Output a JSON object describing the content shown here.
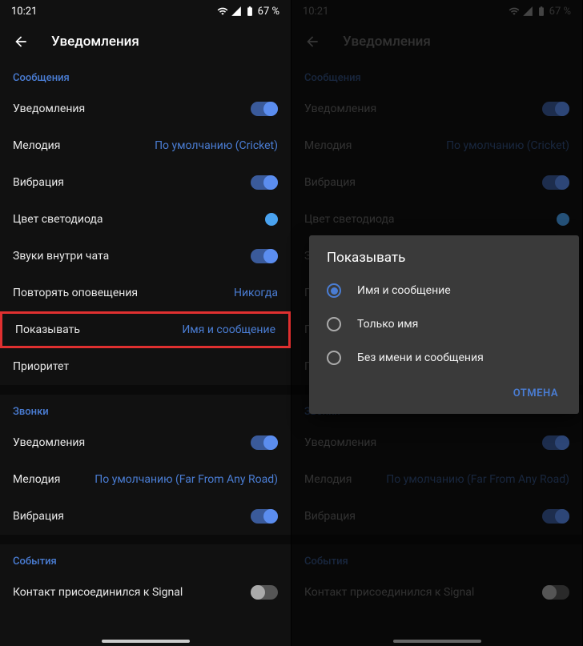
{
  "status": {
    "time": "10:21",
    "battery": "67 %"
  },
  "header": {
    "title": "Уведомления"
  },
  "sections": {
    "messages": {
      "header": "Сообщения",
      "notifications": "Уведомления",
      "melody": "Мелодия",
      "melody_value": "По умолчанию (Cricket)",
      "vibration": "Вибрация",
      "led": "Цвет светодиода",
      "chat_sounds": "Звуки внутри чата",
      "repeat": "Повторять оповещения",
      "repeat_value": "Никогда",
      "show": "Показывать",
      "show_value": "Имя и сообщение",
      "priority": "Приоритет"
    },
    "calls": {
      "header": "Звонки",
      "notifications": "Уведомления",
      "melody": "Мелодия",
      "melody_value": "По умолчанию (Far From Any Road)",
      "vibration": "Вибрация"
    },
    "events": {
      "header": "События",
      "contact_joined": "Контакт присоединился к Signal"
    }
  },
  "dialog": {
    "title": "Показывать",
    "opt1": "Имя и сообщение",
    "opt2": "Только имя",
    "opt3": "Без имени и сообщения",
    "cancel": "ОТМЕНА"
  }
}
